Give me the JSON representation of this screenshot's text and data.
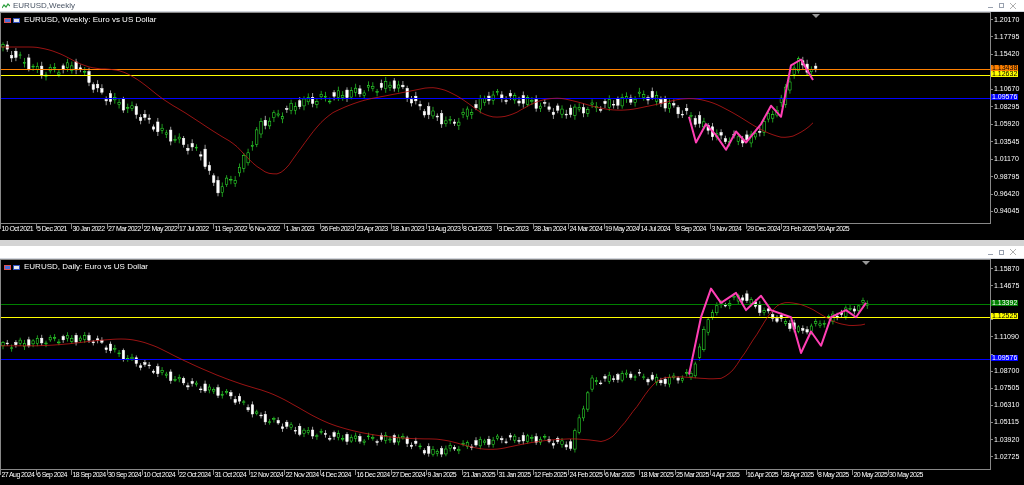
{
  "windows": [
    {
      "title": "EURUSD,Weekly",
      "subtitle": "EURUSD, Weekly: Euro vs US Dollar",
      "price_labels": [
        "1.20170",
        "1.17795",
        "1.15420",
        "1.10670",
        "1.08295",
        "1.05920",
        "1.03545",
        "1.01170",
        "0.98795",
        "0.96420",
        "0.94045"
      ],
      "level_lines": [
        {
          "price": "1.13438",
          "color": "#ff8000"
        },
        {
          "price": "1.12632",
          "color": "#ffff00"
        },
        {
          "price": "1.09576",
          "color": "#0000ff"
        }
      ],
      "date_labels": [
        "10 Oct 2021",
        "5 Dec 2021",
        "30 Jan 2022",
        "27 Mar 2022",
        "22 May 2022",
        "17 Jul 2022",
        "11 Sep 2022",
        "6 Nov 2022",
        "1 Jan 2023",
        "26 Feb 2023",
        "23 Apr 2023",
        "18 Jun 2023",
        "13 Aug 2023",
        "8 Oct 2023",
        "3 Dec 2023",
        "28 Jan 2024",
        "24 Mar 2024",
        "19 May 2024",
        "14 Jul 2024",
        "8 Sep 2024",
        "3 Nov 2024",
        "29 Dec 2024",
        "23 Feb 2025",
        "20 Apr 2025"
      ]
    },
    {
      "subtitle": "EURUSD, Daily: Euro vs US Dollar",
      "price_labels": [
        "1.15870",
        "1.14675",
        "1.11090",
        "1.08700",
        "1.07505",
        "1.06310",
        "1.05115",
        "1.03920",
        "1.02725"
      ],
      "level_lines": [
        {
          "price": "1.13392",
          "color": "#008000"
        },
        {
          "price": "1.12525",
          "color": "#ffff00"
        },
        {
          "price": "1.09576",
          "color": "#0000ff"
        }
      ],
      "date_labels": [
        "27 Aug 2024",
        "6 Sep 2024",
        "18 Sep 2024",
        "30 Sep 2024",
        "10 Oct 2024",
        "22 Oct 2024",
        "31 Oct 2024",
        "12 Nov 2024",
        "22 Nov 2024",
        "4 Dec 2024",
        "16 Dec 2024",
        "27 Dec 2024",
        "9 Jan 2025",
        "21 Jan 2025",
        "31 Jan 2025",
        "12 Feb 2025",
        "24 Feb 2025",
        "6 Mar 2025",
        "18 Mar 2025",
        "25 Mar 2025",
        "4 Apr 2025",
        "16 Apr 2025",
        "28 Apr 2025",
        "8 May 2025",
        "20 May 2025",
        "30 May 2025"
      ]
    }
  ]
}
